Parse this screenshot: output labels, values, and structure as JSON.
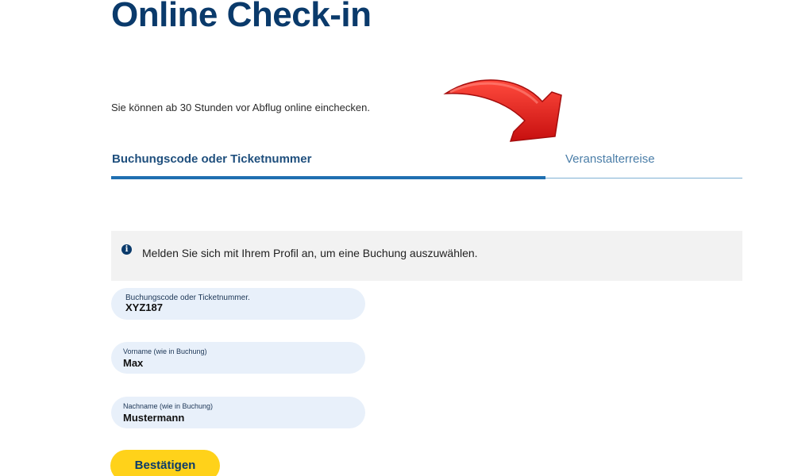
{
  "header": {
    "title": "Online Check-in",
    "subtitle": "Sie können ab 30 Stunden vor Abflug online einchecken."
  },
  "tabs": [
    {
      "label": "Buchungscode oder Ticketnummer",
      "active": true
    },
    {
      "label": "Veranstalterreise",
      "active": false
    }
  ],
  "info": {
    "icon": "info-icon",
    "icon_glyph": "i",
    "text": "Melden Sie sich mit Ihrem Profil an, um eine Buchung auszuwählen."
  },
  "form": {
    "fields": [
      {
        "label": "Buchungscode oder Ticketnummer.",
        "value": "XYZ187"
      },
      {
        "label": "Vorname (wie in Buchung)",
        "value": "Max"
      },
      {
        "label": "Nachname (wie in Buchung)",
        "value": "Mustermann"
      }
    ],
    "submit_label": "Bestätigen"
  },
  "colors": {
    "brand_navy": "#0a3a6b",
    "accent_blue": "#1f6fb1",
    "button_yellow": "#ffd21a",
    "field_bg": "#e8f0fa",
    "info_bg": "#f2f2f2",
    "annotation_arrow": "#e01b1b"
  }
}
